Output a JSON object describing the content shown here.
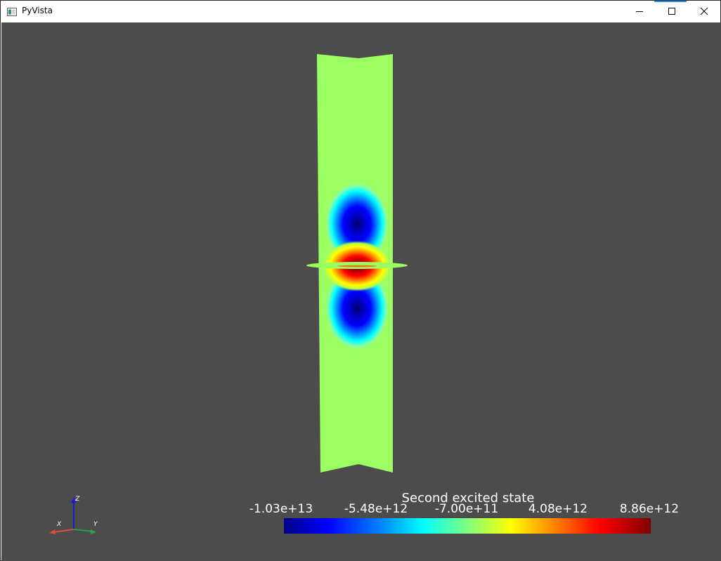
{
  "window": {
    "title": "PyVista",
    "icons": {
      "app": "pyvista-app-icon",
      "minimize": "minimize-icon",
      "maximize": "maximize-icon",
      "close": "close-icon"
    }
  },
  "viewport": {
    "background": "#4c4c4c",
    "field": "Second excited state",
    "axes": {
      "z_label": "Z",
      "x_label": "X",
      "y_label": "Y",
      "colors": {
        "x": "#e0503a",
        "y": "#2f9e44",
        "z": "#1c1cc8"
      }
    },
    "scalar_bar": {
      "title": "Second excited state",
      "ticks": [
        "-1.03e+13",
        "-5.48e+12",
        "-7.00e+11",
        "4.08e+12",
        "8.86e+12"
      ],
      "colormap": "jet"
    }
  }
}
